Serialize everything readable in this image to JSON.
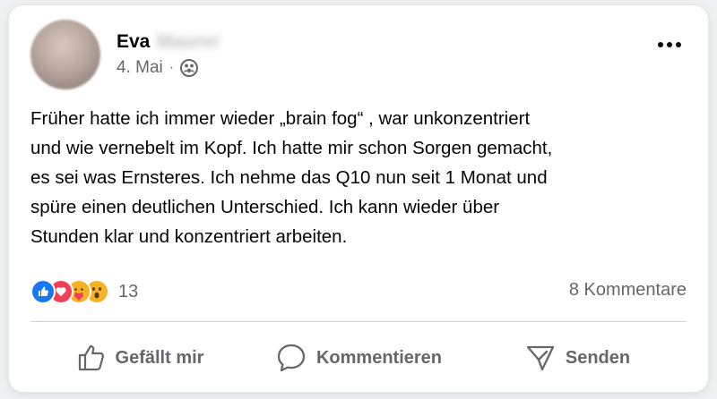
{
  "post": {
    "author_first": "Eva",
    "author_last": "Maurer",
    "date": "4. Mai",
    "separator": "·",
    "audience_icon": "friends-icon",
    "more_icon": "more-icon",
    "text": "Früher hatte ich immer wieder „brain fog“ , war unkonzentriert\nund wie vernebelt im Kopf. Ich hatte mir schon Sorgen gemacht,\nes sei was Ernsteres. Ich nehme das Q10 nun seit 1 Monat und\nspüre einen deutlichen Unterschied. Ich kann wieder über\nStunden klar und konzentriert arbeiten."
  },
  "stats": {
    "reactions": [
      "like",
      "love",
      "care",
      "wow"
    ],
    "reaction_count": "13",
    "comments": "8 Kommentare"
  },
  "actions": {
    "like_label": "Gefällt mir",
    "comment_label": "Kommentieren",
    "share_label": "Senden"
  },
  "colors": {
    "like": "#1877f2",
    "love": "#f33e58",
    "care": "#f7b125",
    "wow": "#f7b125",
    "secondary_text": "#65676b"
  }
}
